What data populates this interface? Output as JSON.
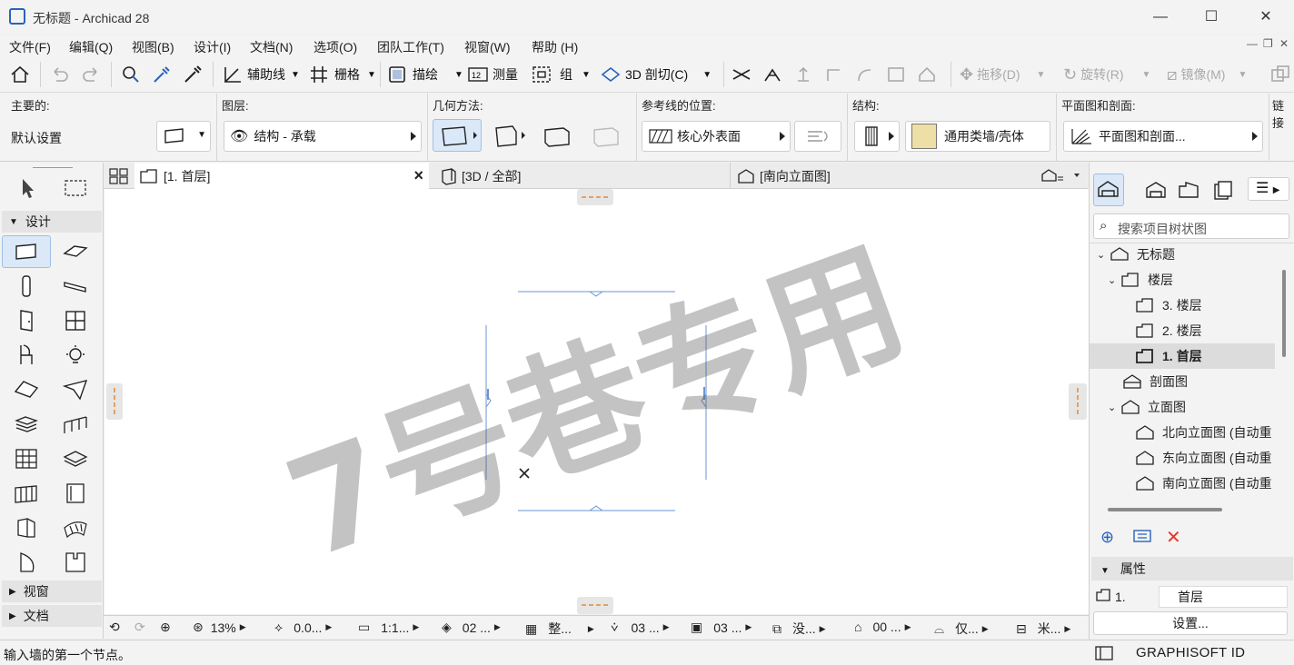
{
  "window": {
    "title": "无标题 - Archicad 28",
    "minimize": "—",
    "maximize": "☐",
    "close": "✕"
  },
  "menu": [
    "文件(F)",
    "编辑(Q)",
    "视图(B)",
    "设计(I)",
    "文档(N)",
    "选项(O)",
    "团队工作(T)",
    "视窗(W)",
    "帮助 (H)"
  ],
  "toolbar": {
    "guides": "辅助线",
    "grid": "栅格",
    "trace": "描绘",
    "measure": "测量",
    "group": "组",
    "cutaway": "3D 剖切(C)",
    "drag": "拖移(D)",
    "rotate": "旋转(R)",
    "mirror": "镜像(M)"
  },
  "infobox": {
    "main_label": "主要的:",
    "main_value": "默认设置",
    "layer_label": "图层:",
    "layer_value": "结构 - 承载",
    "geometry_label": "几何方法:",
    "refline_label": "参考线的位置:",
    "refline_value": "核心外表面",
    "structure_label": "结构:",
    "structure_value": "通用类墙/壳体",
    "floorplan_label": "平面图和剖面:",
    "floorplan_value": "平面图和剖面...",
    "link_label": "链接"
  },
  "toolbox": {
    "section_design": "设计",
    "section_view": "视窗",
    "section_doc": "文档"
  },
  "tabs": {
    "tab1": "[1. 首层]",
    "tab2": "[3D / 全部]",
    "tab3": "[南向立面图]",
    "close": "×"
  },
  "watermark": "7号巷专用",
  "viewbar": {
    "zoom": "13%",
    "angle": "0.0...",
    "scale": "1:1...",
    "layers": "02 ...",
    "structure": "整...",
    "pens": "03 ...",
    "model": "03 ...",
    "setting": "没...",
    "renovation": "00 ...",
    "only": "仅...",
    "unit": "米..."
  },
  "status": {
    "message": "输入墙的第一个节点。",
    "brand": "GRAPHISOFT ID"
  },
  "navigator": {
    "search_placeholder": "搜索项目树状图",
    "tree": [
      {
        "label": "无标题"
      },
      {
        "label": "楼层"
      },
      {
        "label": "3. 楼层"
      },
      {
        "label": "2. 楼层"
      },
      {
        "label": "1. 首层"
      },
      {
        "label": "剖面图"
      },
      {
        "label": "立面图"
      },
      {
        "label": "北向立面图 (自动重"
      },
      {
        "label": "东向立面图 (自动重"
      },
      {
        "label": "南向立面图 (自动重"
      }
    ],
    "properties_title": "属性",
    "prop_num": "1.",
    "prop_name": "首层",
    "settings_button": "设置..."
  },
  "colors": {
    "accent": "#2a63b8",
    "delete": "#e03a2e",
    "selection": "#dbe8f8"
  }
}
